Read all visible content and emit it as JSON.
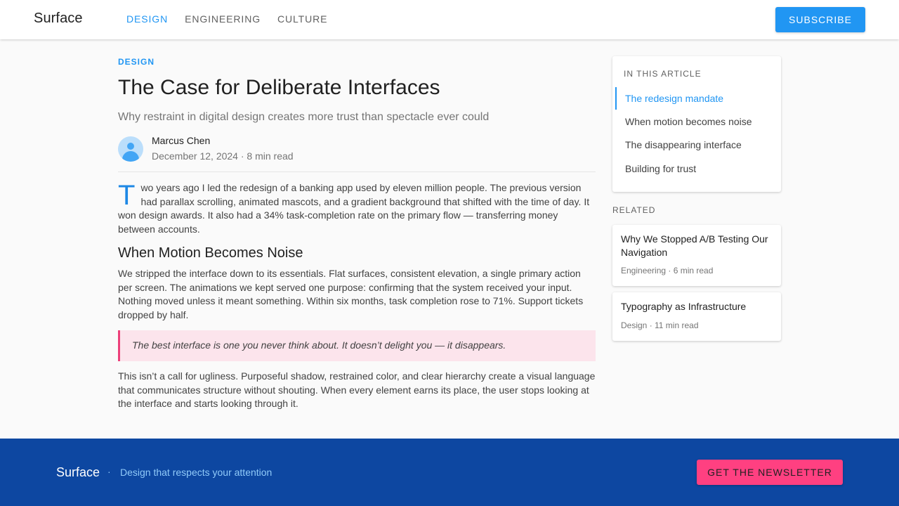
{
  "header": {
    "brand": "Surface",
    "nav": [
      {
        "label": "DESIGN",
        "active": true
      },
      {
        "label": "ENGINEERING",
        "active": false
      },
      {
        "label": "CULTURE",
        "active": false
      }
    ],
    "subscribe_label": "SUBSCRIBE"
  },
  "article": {
    "kicker": "DESIGN",
    "title": "The Case for Deliberate Interfaces",
    "subtitle": "Why restraint in digital design creates more trust than spectacle ever could",
    "author": "Marcus Chen",
    "meta": "December 12, 2024 · 8 min read",
    "dropcap": "T",
    "p1": "wo years ago I led the redesign of a banking app used by eleven million people. The previous version had parallax scrolling, animated mascots, and a gradient background that shifted with the time of day. It won design awards. It also had a 34% task-completion rate on the primary flow — transferring money between accounts.",
    "h2": "When Motion Becomes Noise",
    "p2": "We stripped the interface down to its essentials. Flat surfaces, consistent elevation, a single primary action per screen. The animations we kept served one purpose: confirming that the system received your input. Nothing moved unless it meant something. Within six months, task completion rose to 71%. Support tickets dropped by half.",
    "quote": "The best interface is one you never think about. It doesn’t delight you — it disappears.",
    "p3": "This isn’t a call for ugliness. Purposeful shadow, restrained color, and clear hierarchy create a visual language that communicates structure without shouting. When every element earns its place, the user stops looking at the interface and starts looking through it."
  },
  "toc": {
    "heading": "IN THIS ARTICLE",
    "items": [
      {
        "label": "The redesign mandate",
        "active": true
      },
      {
        "label": "When motion becomes noise",
        "active": false
      },
      {
        "label": "The disappearing interface",
        "active": false
      },
      {
        "label": "Building for trust",
        "active": false
      }
    ]
  },
  "related": {
    "heading": "RELATED",
    "cards": [
      {
        "title": "Why We Stopped A/B Testing Our Navigation",
        "meta": "Engineering · 6 min read"
      },
      {
        "title": "Typography as Infrastructure",
        "meta": "Design · 11 min read"
      }
    ]
  },
  "footer": {
    "brand": "Surface",
    "separator": "·",
    "tagline": "Design that respects your attention",
    "cta_label": "GET THE NEWSLETTER"
  },
  "colors": {
    "primary": "#2196f3",
    "footer_bg": "#0d47a1",
    "accent": "#ff4081",
    "quote_bg": "#fce4ec"
  }
}
